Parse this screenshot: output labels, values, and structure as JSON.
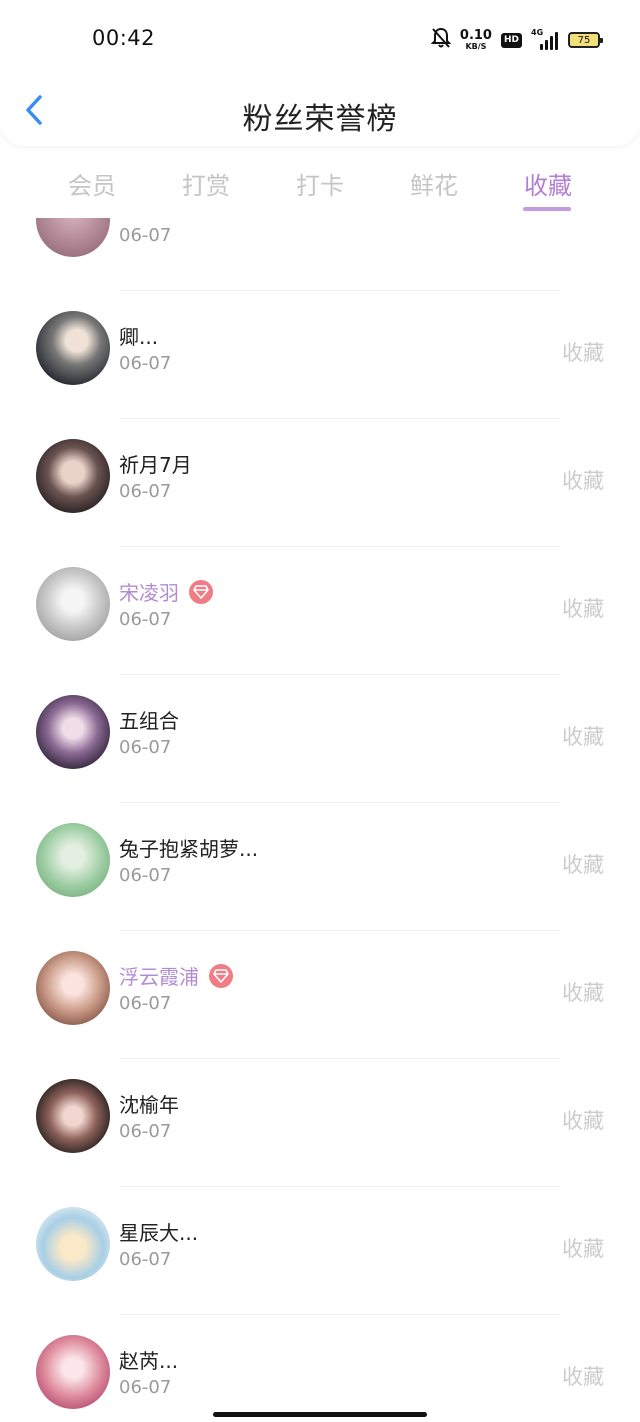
{
  "status_bar": {
    "time": "00:42",
    "net_speed": "0.10",
    "net_unit": "KB/S",
    "hd_label": "HD",
    "signal_label": "4G",
    "battery": "75",
    "icons": [
      "bell-mute-icon",
      "hd-icon",
      "signal-icon",
      "battery-icon"
    ]
  },
  "header": {
    "title": "粉丝荣誉榜",
    "back_icon": "chevron-left-icon"
  },
  "tabs": [
    {
      "label": "会员",
      "active": false
    },
    {
      "label": "打赏",
      "active": false
    },
    {
      "label": "打卡",
      "active": false
    },
    {
      "label": "鲜花",
      "active": false
    },
    {
      "label": "收藏",
      "active": true
    }
  ],
  "list": {
    "rows": [
      {
        "name": "",
        "date": "06-07",
        "action": "",
        "vip": false
      },
      {
        "name": "卿...",
        "date": "06-07",
        "action": "收藏",
        "vip": false
      },
      {
        "name": "祈月7月",
        "date": "06-07",
        "action": "收藏",
        "vip": false
      },
      {
        "name": "宋凌羽",
        "date": "06-07",
        "action": "收藏",
        "vip": true
      },
      {
        "name": "五组合",
        "date": "06-07",
        "action": "收藏",
        "vip": false
      },
      {
        "name": "兔子抱紧胡萝...",
        "date": "06-07",
        "action": "收藏",
        "vip": false
      },
      {
        "name": "浮云霞浦",
        "date": "06-07",
        "action": "收藏",
        "vip": true
      },
      {
        "name": "沈榆年",
        "date": "06-07",
        "action": "收藏",
        "vip": false
      },
      {
        "name": "星辰大...",
        "date": "06-07",
        "action": "收藏",
        "vip": false
      },
      {
        "name": "赵芮...",
        "date": "06-07",
        "action": "收藏",
        "vip": false
      }
    ]
  },
  "colors": {
    "accent": "#b37fd4",
    "vip_name": "#b38bd3",
    "vip_badge": "#ef7d86",
    "inactive_tab": "#c5c5c5"
  }
}
